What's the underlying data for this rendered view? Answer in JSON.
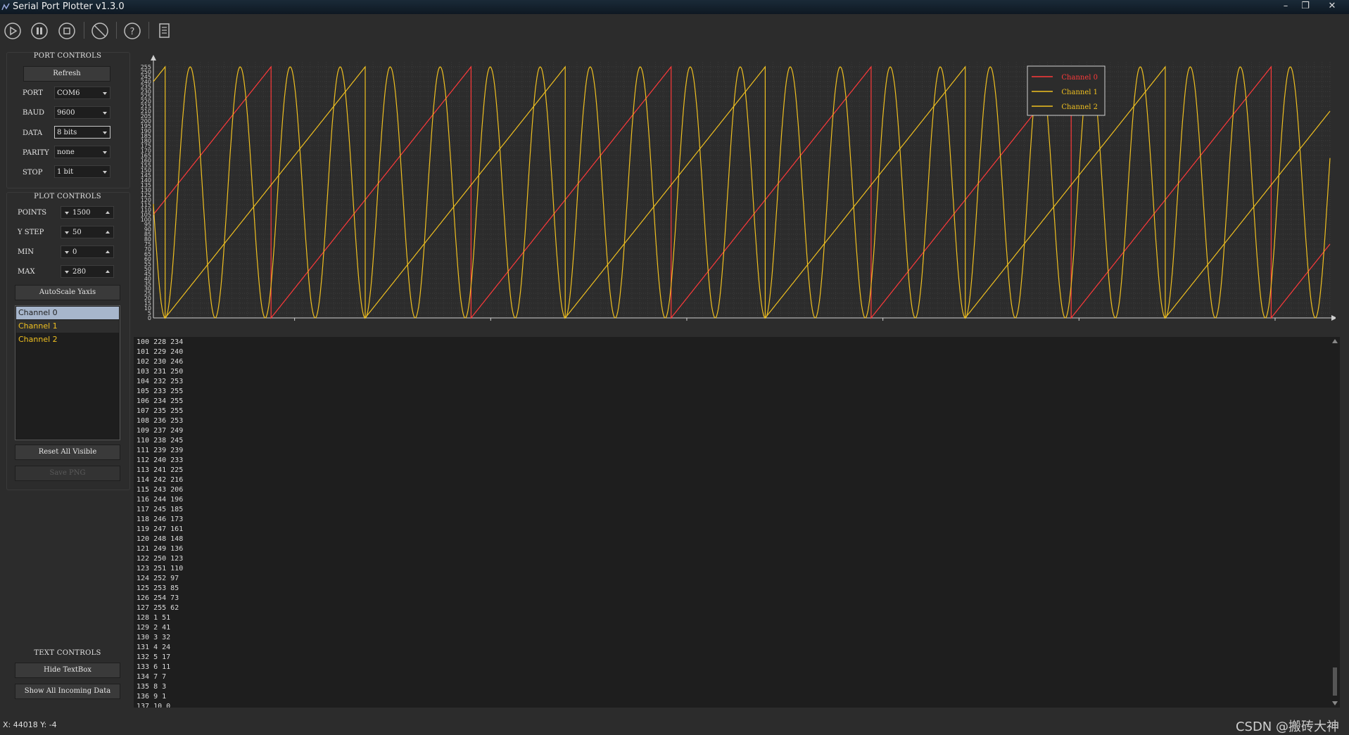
{
  "window": {
    "title": "Serial Port Plotter v1.3.0"
  },
  "port_controls": {
    "title": "PORT CONTROLS",
    "refresh_label": "Refresh",
    "port_label": "PORT",
    "port_value": "COM6",
    "baud_label": "BAUD",
    "baud_value": "9600",
    "data_label": "DATA",
    "data_value": "8 bits",
    "parity_label": "PARITY",
    "parity_value": "none",
    "stop_label": "STOP",
    "stop_value": "1 bit"
  },
  "plot_controls": {
    "title": "PLOT CONTROLS",
    "points_label": "POINTS",
    "points_value": "1500",
    "ystep_label": "Y STEP",
    "ystep_value": "50",
    "min_label": "MIN",
    "min_value": "0",
    "max_label": "MAX",
    "max_value": "280",
    "autoscale_label": "AutoScale Yaxis",
    "channels": [
      {
        "label": "Channel 0",
        "color": "#ff3a3a",
        "selected": true
      },
      {
        "label": "Channel 1",
        "color": "#f0c020",
        "selected": false
      },
      {
        "label": "Channel 2",
        "color": "#f0c020",
        "selected": false
      }
    ],
    "reset_visible_label": "Reset All Visible",
    "save_png_label": "Save PNG"
  },
  "text_controls": {
    "title": "TEXT CONTROLS",
    "hide_textbox_label": "Hide TextBox",
    "show_incoming_label": "Show All Incoming Data"
  },
  "text_output": {
    "lines": [
      "100 228 234",
      "101 229 240",
      "102 230 246",
      "103 231 250",
      "104 232 253",
      "105 233 255",
      "106 234 255",
      "107 235 255",
      "108 236 253",
      "109 237 249",
      "110 238 245",
      "111 239 239",
      "112 240 233",
      "113 241 225",
      "114 242 216",
      "115 243 206",
      "116 244 196",
      "117 245 185",
      "118 246 173",
      "119 247 161",
      "120 248 148",
      "121 249 136",
      "122 250 123",
      "123 251 110",
      "124 252 97",
      "125 253 85",
      "126 254 73",
      "127 255 62",
      "128 1 51",
      "129 2 41",
      "130 3 32",
      "131 4 24",
      "132 5 17",
      "133 6 11",
      "134 7 7",
      "135 8 3",
      "136 9 1",
      "137 10 0"
    ]
  },
  "status": {
    "coords": "X: 44018 Y: -4",
    "watermark": "CSDN @搬砖大神"
  },
  "chart_data": {
    "type": "line",
    "xlim": [
      43820,
      45320
    ],
    "ylim": [
      0,
      260
    ],
    "x_ticks": [
      44000,
      44250,
      44500,
      44750,
      45000,
      45250
    ],
    "y_ticks": [
      0,
      5,
      10,
      15,
      20,
      25,
      30,
      35,
      40,
      45,
      50,
      55,
      60,
      65,
      70,
      75,
      80,
      85,
      90,
      95,
      100,
      105,
      110,
      115,
      120,
      125,
      130,
      135,
      140,
      145,
      150,
      155,
      160,
      165,
      170,
      175,
      180,
      185,
      190,
      195,
      200,
      205,
      210,
      215,
      220,
      225,
      230,
      235,
      240,
      245,
      250,
      255
    ],
    "legend_position": "top-right",
    "grid": true,
    "series": [
      {
        "name": "Channel 0",
        "color": "#ff3a3a",
        "waveform": "sawtooth",
        "period": 255,
        "min": 0,
        "max": 255,
        "phase_x": 43970
      },
      {
        "name": "Channel 1",
        "color": "#f0c020",
        "waveform": "sawtooth",
        "period": 255,
        "min": 0,
        "max": 255,
        "phase_x": 43835
      },
      {
        "name": "Channel 2",
        "color": "#f0c020",
        "waveform": "sine",
        "period": 63.75,
        "min": 0,
        "max": 255,
        "phase_x": 43835
      }
    ]
  }
}
